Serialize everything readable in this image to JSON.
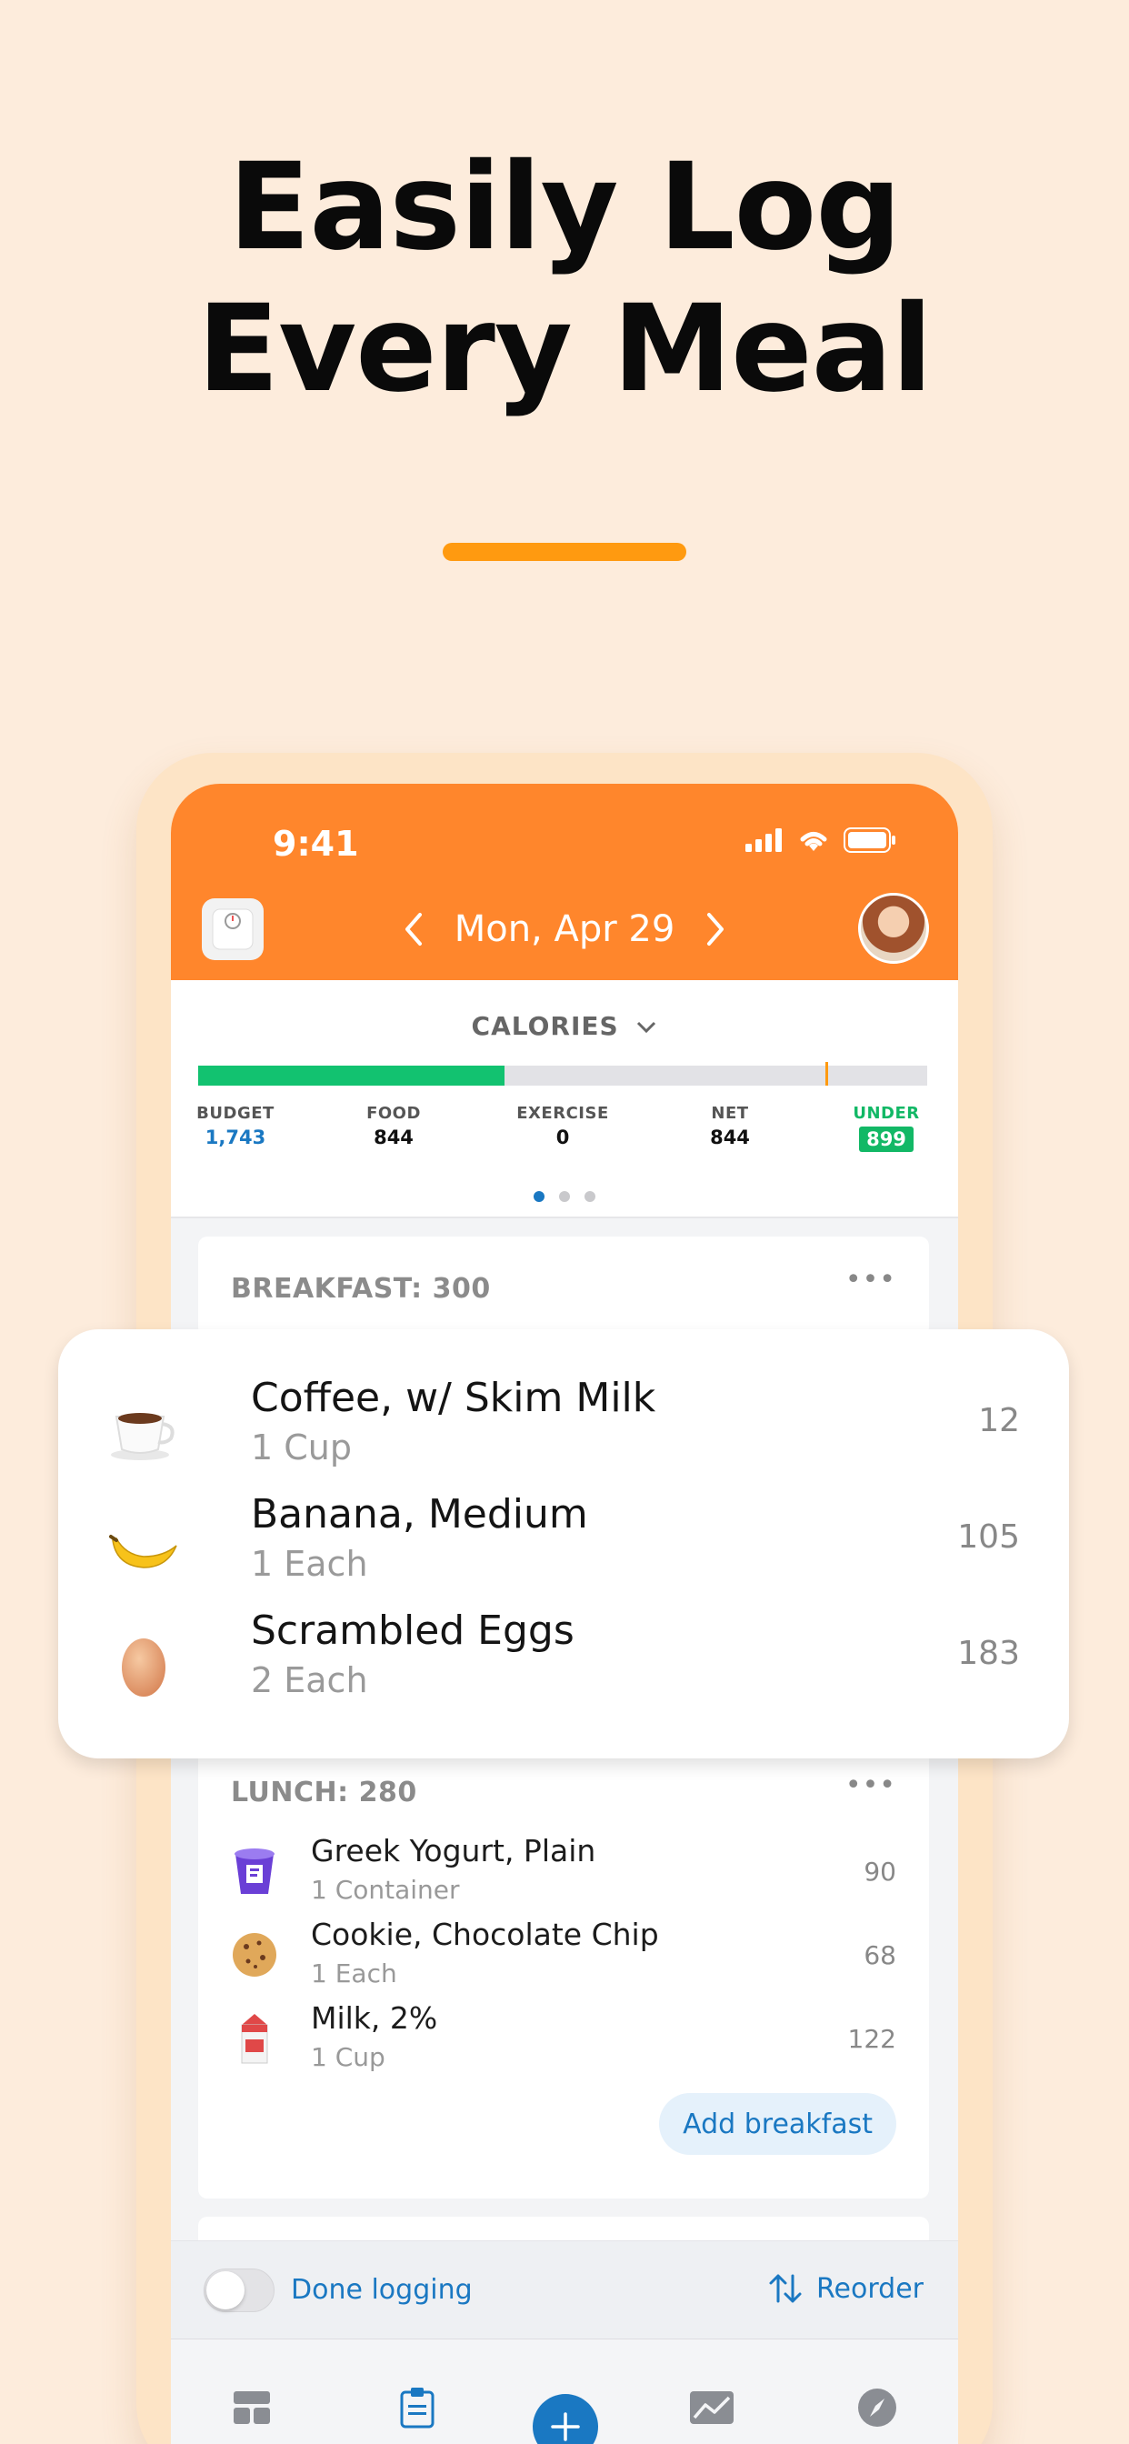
{
  "headline": {
    "line1": "Easily Log",
    "line2": "Every Meal"
  },
  "status_bar": {
    "time": "9:41"
  },
  "header": {
    "date": "Mon, Apr 29"
  },
  "calories": {
    "title": "CALORIES",
    "progress_fraction": 0.42,
    "budget_marker_fraction": 0.86,
    "stats": {
      "budget_label": "BUDGET",
      "budget_value": "1,743",
      "food_label": "FOOD",
      "food_value": "844",
      "exercise_label": "EXERCISE",
      "exercise_value": "0",
      "net_label": "NET",
      "net_value": "844",
      "under_label": "UNDER",
      "under_value": "899"
    },
    "page_indicator": {
      "count": 3,
      "active": 0
    }
  },
  "breakfast": {
    "title": "BREAKFAST: 300",
    "items": [
      {
        "name": "Coffee, w/ Skim Milk",
        "serving": "1 Cup",
        "calories": "12",
        "icon": "coffee-cup-icon"
      },
      {
        "name": "Banana, Medium",
        "serving": "1 Each",
        "calories": "105",
        "icon": "banana-icon"
      },
      {
        "name": "Scrambled Eggs",
        "serving": "2 Each",
        "calories": "183",
        "icon": "egg-icon"
      }
    ]
  },
  "lunch": {
    "title": "LUNCH: 280",
    "items": [
      {
        "name": "Greek Yogurt, Plain",
        "serving": "1 Container",
        "calories": "90",
        "icon": "yogurt-icon"
      },
      {
        "name": "Cookie, Chocolate Chip",
        "serving": "1 Each",
        "calories": "68",
        "icon": "cookie-icon"
      },
      {
        "name": "Milk, 2%",
        "serving": "1 Cup",
        "calories": "122",
        "icon": "milk-carton-icon"
      }
    ],
    "add_button": "Add breakfast"
  },
  "logging_bar": {
    "done_label": "Done logging",
    "reorder_label": "Reorder",
    "done_toggle_on": false
  },
  "tabs": [
    "dashboard-icon",
    "log-icon",
    "add-icon",
    "trends-icon",
    "discover-icon"
  ],
  "colors": {
    "background": "#fdecdc",
    "accent_orange": "#ff862c",
    "accent_bar": "#ff9a10",
    "calorie_green": "#12c270",
    "link_blue": "#1a78c2"
  }
}
